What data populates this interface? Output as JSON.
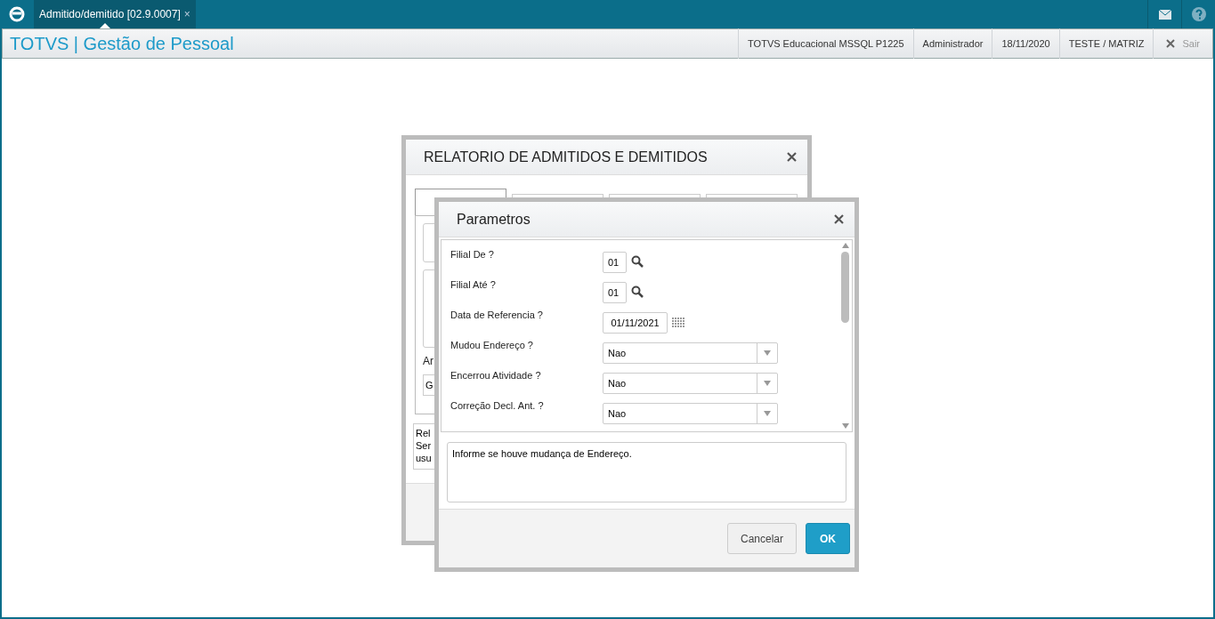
{
  "top_bar": {
    "tabs": [
      {
        "label": "Admitido/demitido [02.9.0007]",
        "close": "×",
        "selected": true
      }
    ]
  },
  "header": {
    "title": "TOTVS | Gestão de Pessoal",
    "info": [
      "TOTVS Educacional MSSQL P1225",
      "Administrador",
      "18/11/2020",
      "TESTE / MATRIZ"
    ],
    "exit": "Sair"
  },
  "report_dialog": {
    "title": "RELATORIO DE ADMITIDOS E DEMITIDOS",
    "tabs": [
      {
        "selected": true
      },
      {
        "selected": false
      },
      {
        "selected": false
      },
      {
        "selected": false
      }
    ],
    "field_label": "Ar",
    "field_value": "G",
    "description_lines": [
      "Rel",
      "Ser",
      "usu"
    ]
  },
  "params_dialog": {
    "title": "Parametros",
    "fields": [
      {
        "label": "Filial De ?",
        "kind": "lookup",
        "value": "01"
      },
      {
        "label": "Filial Até ?",
        "kind": "lookup",
        "value": "01"
      },
      {
        "label": "Data de Referencia ?",
        "kind": "date",
        "value": "01/11/2021"
      },
      {
        "label": "Mudou Endereço ?",
        "kind": "select",
        "value": "Nao"
      },
      {
        "label": "Encerrou Atividade ?",
        "kind": "select",
        "value": "Nao"
      },
      {
        "label": "Correção Decl. Ant. ?",
        "kind": "select",
        "value": "Nao"
      }
    ],
    "help": "Informe se houve mudança de Endereço.",
    "buttons": [
      {
        "label": "Cancelar",
        "kind": "secondary"
      },
      {
        "label": "OK",
        "kind": "primary"
      }
    ]
  }
}
